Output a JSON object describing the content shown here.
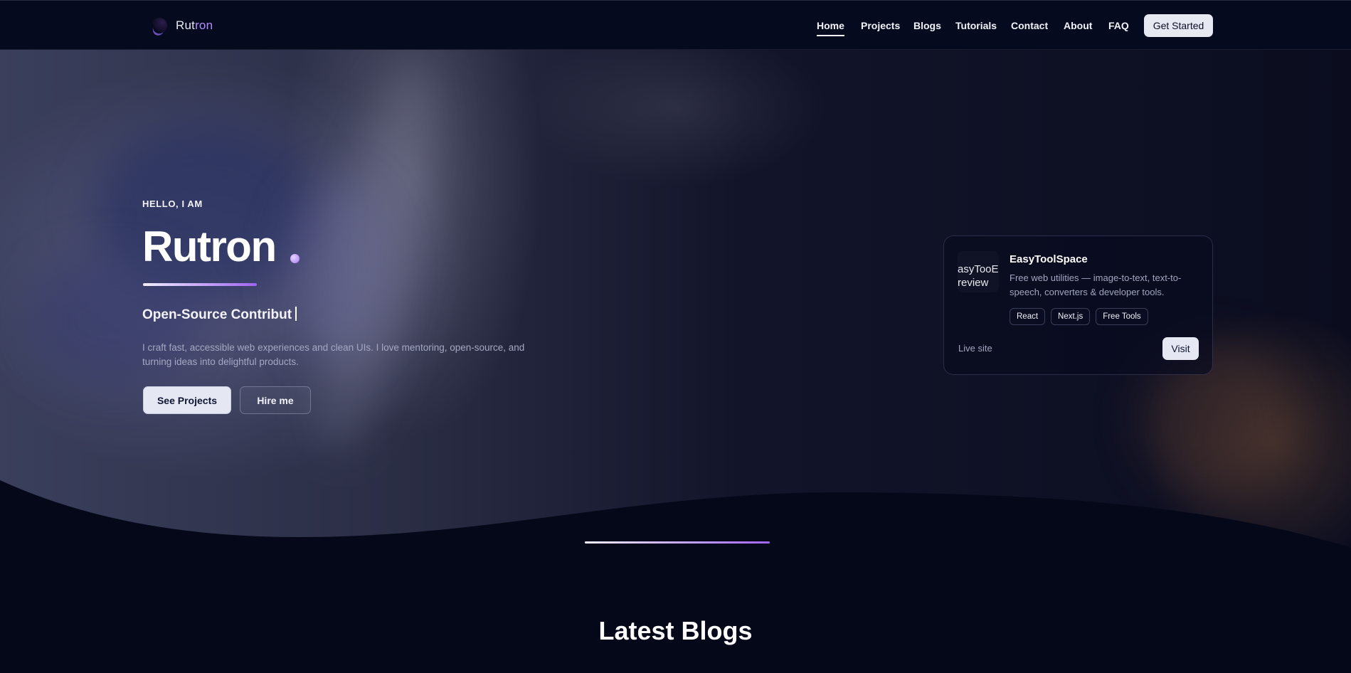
{
  "header": {
    "logo_part1": "Rut",
    "logo_part2": "ron",
    "nav": [
      "Home",
      "Projects",
      "Blogs",
      "Tutorials",
      "Contact",
      "About",
      "FAQ"
    ],
    "active_nav": "Home",
    "cta_label": "Get Started"
  },
  "hero": {
    "eyebrow": "HELLO, I AM",
    "name": "Rutron",
    "role": "Open-Source Contribut",
    "description": "I craft fast, accessible web experiences and clean UIs. I love mentoring, open-source, and turning ideas into delightful products.",
    "primary_button": "See Projects",
    "secondary_button": "Hire me"
  },
  "project_card": {
    "thumb_line1": "asyTooE",
    "thumb_line2": "review",
    "title": "EasyToolSpace",
    "description": "Free web utilities — image-to-text, text-to-speech, converters & developer tools.",
    "tags": [
      "React",
      "Next.js",
      "Free Tools"
    ],
    "status": "Live site",
    "visit_label": "Visit"
  },
  "section": {
    "title": "Latest Blogs"
  },
  "colors": {
    "background": "#050818",
    "accent": "#a064f2",
    "button_light": "#e5e8f3"
  }
}
